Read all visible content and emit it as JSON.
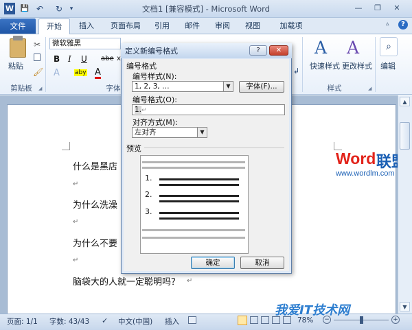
{
  "window": {
    "title": "文档1 [兼容模式] - Microsoft Word",
    "controls": {
      "minimize": "—",
      "restore": "❐",
      "close": "✕"
    }
  },
  "quick_access": {
    "word_icon": "W",
    "save": "💾",
    "undo": "↶",
    "redo": "↻",
    "customize": "▾"
  },
  "tabs": {
    "file": "文件",
    "items": [
      "开始",
      "插入",
      "页面布局",
      "引用",
      "邮件",
      "审阅",
      "视图",
      "加载项"
    ]
  },
  "ribbon": {
    "clipboard": {
      "paste": "粘贴",
      "group": "剪贴板"
    },
    "font": {
      "name": "微软雅黑",
      "group": "字体",
      "bold": "B",
      "italic": "I",
      "underline": "U",
      "strike": "abe",
      "sub": "x₂",
      "color_a": "A",
      "highlight": "aby",
      "fontcolor": "A"
    },
    "styles": {
      "quick": "快速样式",
      "change": "更改样式",
      "group": "样式"
    },
    "editing": {
      "label": "编辑"
    }
  },
  "document": {
    "lines": [
      "什么是黑店",
      "为什么洗澡",
      "为什么不要",
      "脑袋大的人就一定聪明吗？"
    ],
    "para_mark": "↵"
  },
  "watermark": {
    "word": "Word",
    "union": "联盟",
    "url": "www.wordlm.com",
    "site": "我爱IT技术网"
  },
  "status": {
    "page": "页面: 1/1",
    "words": "字数: 43/43",
    "language": "中文(中国)",
    "insert": "插入",
    "zoom": "78%"
  },
  "dialog": {
    "title": "定义新编号格式",
    "help": "?",
    "close": "✕",
    "section_format": "编号格式",
    "style_label": "编号样式(N):",
    "style_value": "1, 2, 3, …",
    "font_button": "字体(F)...",
    "format_label": "编号格式(O):",
    "format_value": "1.",
    "align_label": "对齐方式(M):",
    "align_value": "左对齐",
    "preview_label": "预览",
    "preview_numbers": [
      "1.",
      "2.",
      "3."
    ],
    "ok": "确定",
    "cancel": "取消"
  }
}
